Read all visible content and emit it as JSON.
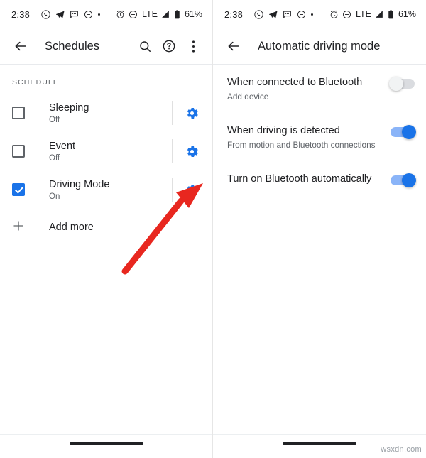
{
  "left": {
    "status": {
      "time": "2:38",
      "left_icons": [
        "whatsapp-icon",
        "telegram-icon",
        "messages-icon",
        "do-not-disturb-icon",
        "more-dot-icon"
      ],
      "right_icons": [
        "alarm-icon",
        "dnd-icon",
        "signal-icon"
      ],
      "network": "LTE",
      "battery": "61%"
    },
    "appbar": {
      "back": "back-arrow-icon",
      "title": "Schedules",
      "actions": [
        "search-icon",
        "help-icon",
        "overflow-menu-icon"
      ]
    },
    "section_label": "SCHEDULE",
    "items": [
      {
        "title": "Sleeping",
        "subtitle": "Off",
        "checked": false,
        "gear": "settings-gear-icon"
      },
      {
        "title": "Event",
        "subtitle": "Off",
        "checked": false,
        "gear": "settings-gear-icon"
      },
      {
        "title": "Driving Mode",
        "subtitle": "On",
        "checked": true,
        "gear": "settings-gear-icon"
      }
    ],
    "add_more": "Add more"
  },
  "right": {
    "status": {
      "time": "2:38",
      "network": "LTE",
      "battery": "61%"
    },
    "appbar": {
      "back": "back-arrow-icon",
      "title": "Automatic driving mode"
    },
    "settings": [
      {
        "title": "When connected to Bluetooth",
        "subtitle": "Add device",
        "toggle": "off"
      },
      {
        "title": "When driving is detected",
        "subtitle": "From motion and Bluetooth connections",
        "toggle": "on"
      },
      {
        "title": "Turn on Bluetooth automatically",
        "subtitle": "",
        "toggle": "on"
      }
    ]
  },
  "annotation": {
    "arrow_color": "#e8271f",
    "arrow_target": "driving-mode-gear"
  },
  "watermark": "wsxdn.com",
  "colors": {
    "accent": "#1a73e8",
    "text_primary": "#202124",
    "text_secondary": "#5f6368",
    "arrow": "#e8271f"
  }
}
